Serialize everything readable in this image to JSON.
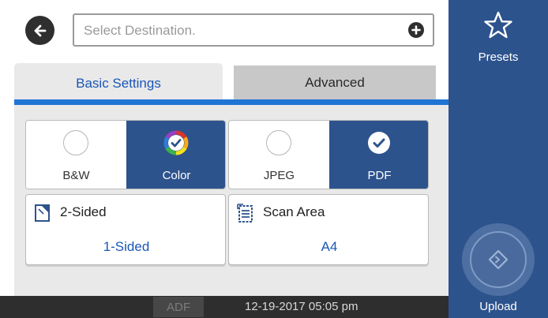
{
  "destination": {
    "placeholder": "Select Destination."
  },
  "tabs": [
    {
      "label": "Basic Settings",
      "selected": true
    },
    {
      "label": "Advanced",
      "selected": false
    }
  ],
  "color_mode": {
    "options": [
      {
        "label": "B&W",
        "selected": false
      },
      {
        "label": "Color",
        "selected": true
      }
    ]
  },
  "file_format": {
    "options": [
      {
        "label": "JPEG",
        "selected": false
      },
      {
        "label": "PDF",
        "selected": true
      }
    ]
  },
  "settings": [
    {
      "title": "2-Sided",
      "value": "1-Sided",
      "icon": "two-sided-icon"
    },
    {
      "title": "Scan Area",
      "value": "A4",
      "icon": "scan-area-icon"
    }
  ],
  "status": {
    "source": "ADF",
    "datetime": "12-19-2017 05:05 pm"
  },
  "sidebar": {
    "presets_label": "Presets",
    "upload_label": "Upload"
  },
  "colors": {
    "sidebar": "#2d538d",
    "accent": "#1f75d4",
    "link_text": "#1a56b8"
  }
}
